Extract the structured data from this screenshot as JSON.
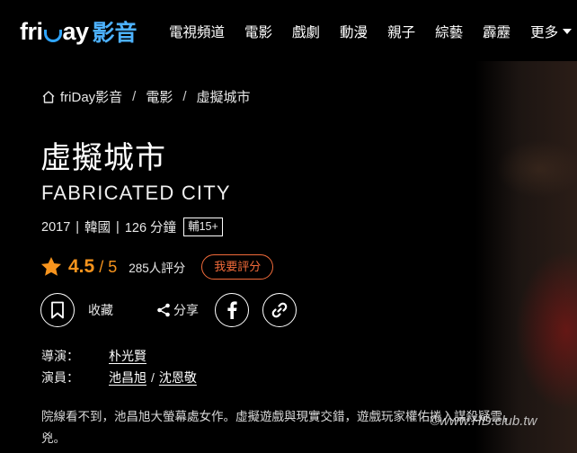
{
  "header": {
    "logo_en_1": "fri",
    "logo_en_2": "ay",
    "logo_zh": "影音",
    "nav": [
      "電視頻道",
      "電影",
      "戲劇",
      "動漫",
      "親子",
      "綜藝",
      "霹靂"
    ],
    "more_label": "更多"
  },
  "breadcrumb": {
    "items": [
      "friDay影音",
      "電影",
      "虛擬城市"
    ],
    "separator": "/"
  },
  "title": {
    "zh": "虛擬城市",
    "en": "FABRICATED CITY"
  },
  "meta": {
    "year": "2017",
    "country": "韓國",
    "duration": "126 分鐘",
    "sep": "|",
    "rating_badge": "輔15+"
  },
  "score": {
    "value": "4.5",
    "max": "/ 5",
    "votes": "285人評分",
    "rate_button": "我要評分",
    "accent": "#f7941d",
    "rate_color": "#f26b3a"
  },
  "actions": {
    "favorite": "收藏",
    "share": "分享",
    "icons": [
      "bookmark-icon",
      "share-icon",
      "facebook-icon",
      "link-icon"
    ]
  },
  "credits": {
    "director_label": "導演：",
    "director": "朴光賢",
    "cast_label": "演員：",
    "cast_1": "池昌旭",
    "cast_2": "沈恩敬",
    "cast_sep": "/"
  },
  "synopsis": {
    "line1": "院線看不到，池昌旭大螢幕處女作。虛擬遊戲與現實交錯，遊戲玩家權佑捲入謀殺疑雲，",
    "line2": "兇。"
  },
  "watermark": "©www.HD.club.tw"
}
